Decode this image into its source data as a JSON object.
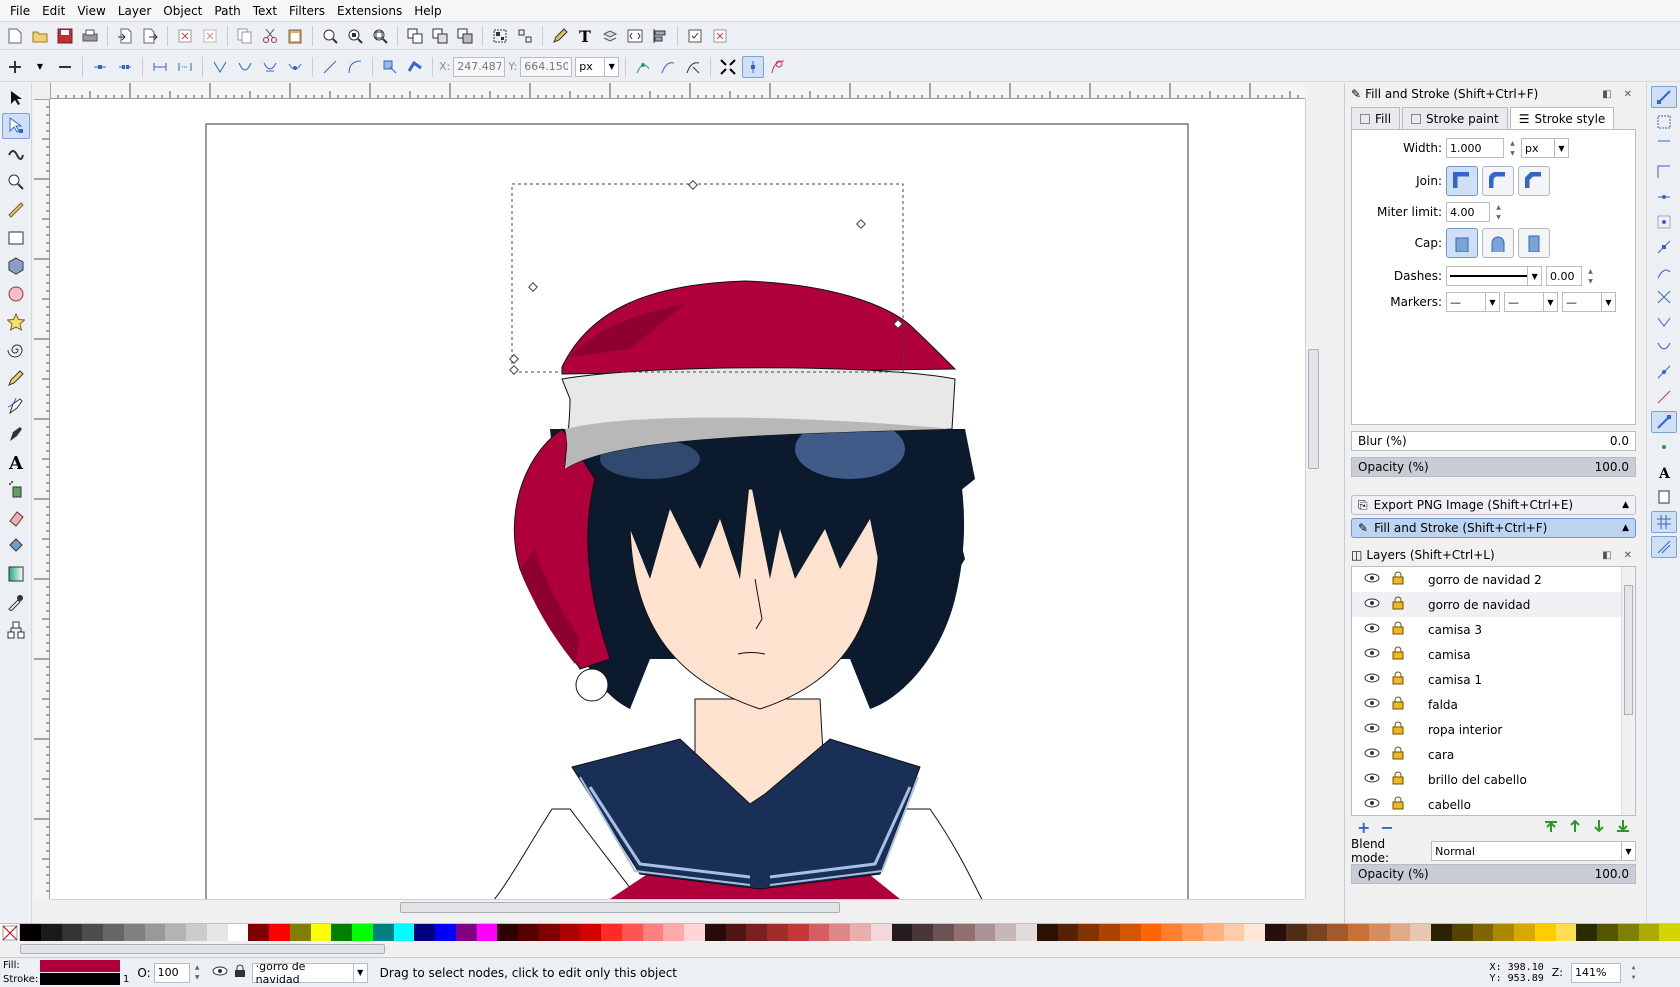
{
  "menu": [
    {
      "label": "File"
    },
    {
      "label": "Edit"
    },
    {
      "label": "View"
    },
    {
      "label": "Layer"
    },
    {
      "label": "Object"
    },
    {
      "label": "Path"
    },
    {
      "label": "Text"
    },
    {
      "label": "Filters"
    },
    {
      "label": "Extensions"
    },
    {
      "label": "Help"
    }
  ],
  "controls": {
    "x_label": "X:",
    "x_value": "247.487",
    "y_label": "Y:",
    "y_value": "664.150",
    "unit": "px"
  },
  "panel": {
    "fill_stroke_title": "Fill and Stroke (Shift+Ctrl+F)",
    "tabs": {
      "fill": "Fill",
      "stroke_paint": "Stroke paint",
      "stroke_style": "Stroke style"
    },
    "width_label": "Width:",
    "width_value": "1.000",
    "width_unit": "px",
    "join_label": "Join:",
    "miter_label": "Miter limit:",
    "miter_value": "4.00",
    "cap_label": "Cap:",
    "dashes_label": "Dashes:",
    "dashes_offset": "0.00",
    "markers_label": "Markers:",
    "blur_label": "Blur (%)",
    "blur_value": "0.0",
    "opacity_label": "Opacity (%)",
    "opacity_value": "100.0",
    "opacity_fraction": 1.0,
    "export_label": "Export PNG Image (Shift+Ctrl+E)",
    "fill_stroke_collapsed": "Fill and Stroke (Shift+Ctrl+F)",
    "layers_title": "Layers (Shift+Ctrl+L)",
    "layers": [
      {
        "name": "gorro de navidad 2",
        "selected": false
      },
      {
        "name": "gorro de navidad",
        "selected": true
      },
      {
        "name": "camisa 3",
        "selected": false
      },
      {
        "name": "camisa",
        "selected": false
      },
      {
        "name": "camisa 1",
        "selected": false
      },
      {
        "name": "falda",
        "selected": false
      },
      {
        "name": "ropa interior",
        "selected": false
      },
      {
        "name": "cara",
        "selected": false
      },
      {
        "name": "brillo del cabello",
        "selected": false
      },
      {
        "name": "cabello",
        "selected": false
      }
    ],
    "blend_label": "Blend mode:",
    "blend_value": "Normal",
    "layer_opacity_label": "Opacity (%)",
    "layer_opacity_value": "100.0",
    "layer_opacity_fraction": 1.0
  },
  "status": {
    "fill_label": "Fill:",
    "stroke_label": "Stroke:",
    "fill_color": "#b0003c",
    "stroke_color": "#000000",
    "stroke_width": "1",
    "opacity_label": "O:",
    "opacity_value": "100",
    "layer_value": "·gorro de navidad",
    "message": "Drag to select nodes, click to edit only this object",
    "cx_label": "X:",
    "cx_value": "398.10",
    "cy_label": "Y:",
    "cy_value": "953.89",
    "zoom_label": "Z:",
    "zoom_value": "141%"
  },
  "palette": [
    "#000000",
    "#1a1a1a",
    "#333333",
    "#4d4d4d",
    "#666666",
    "#808080",
    "#999999",
    "#b3b3b3",
    "#cccccc",
    "#e6e6e6",
    "#ffffff",
    "#800000",
    "#ff0000",
    "#808000",
    "#ffff00",
    "#008000",
    "#00ff00",
    "#008080",
    "#00ffff",
    "#000080",
    "#0000ff",
    "#800080",
    "#ff00ff",
    "#2b0000",
    "#550000",
    "#800000",
    "#aa0000",
    "#d40000",
    "#ff2a2a",
    "#ff5555",
    "#ff8080",
    "#ffaaaa",
    "#ffd5d5",
    "#280b0b",
    "#501616",
    "#782121",
    "#a02c2c",
    "#c83737",
    "#d35f5f",
    "#de8787",
    "#e9afaf",
    "#f4d7d7",
    "#241c1c",
    "#483737",
    "#6c5353",
    "#916f6f",
    "#ac9393",
    "#c8b7b7",
    "#e3dbdb",
    "#2b1100",
    "#552200",
    "#803300",
    "#aa4400",
    "#d45500",
    "#ff6600",
    "#ff7f2a",
    "#ff9955",
    "#ffb380",
    "#ffccaa",
    "#ffe6d5",
    "#280f0b",
    "#502d16",
    "#784421",
    "#a05a2c",
    "#c87137",
    "#d38d5f",
    "#deaa87",
    "#e9c6af",
    "#2b2200",
    "#554400",
    "#806600",
    "#aa8800",
    "#d4aa00",
    "#ffcc00",
    "#ffdd55",
    "#2b2b00",
    "#555500",
    "#808000",
    "#aaaa00",
    "#d4d400"
  ],
  "colors": {
    "hat": "#b0003c",
    "hat_dark": "#8e002f",
    "hat_brim": "#e8e8e8",
    "hair": "#0c1a2e",
    "skin": "#fde3cf",
    "uniform": "#1a2f55",
    "accent": "#6d98cf"
  }
}
